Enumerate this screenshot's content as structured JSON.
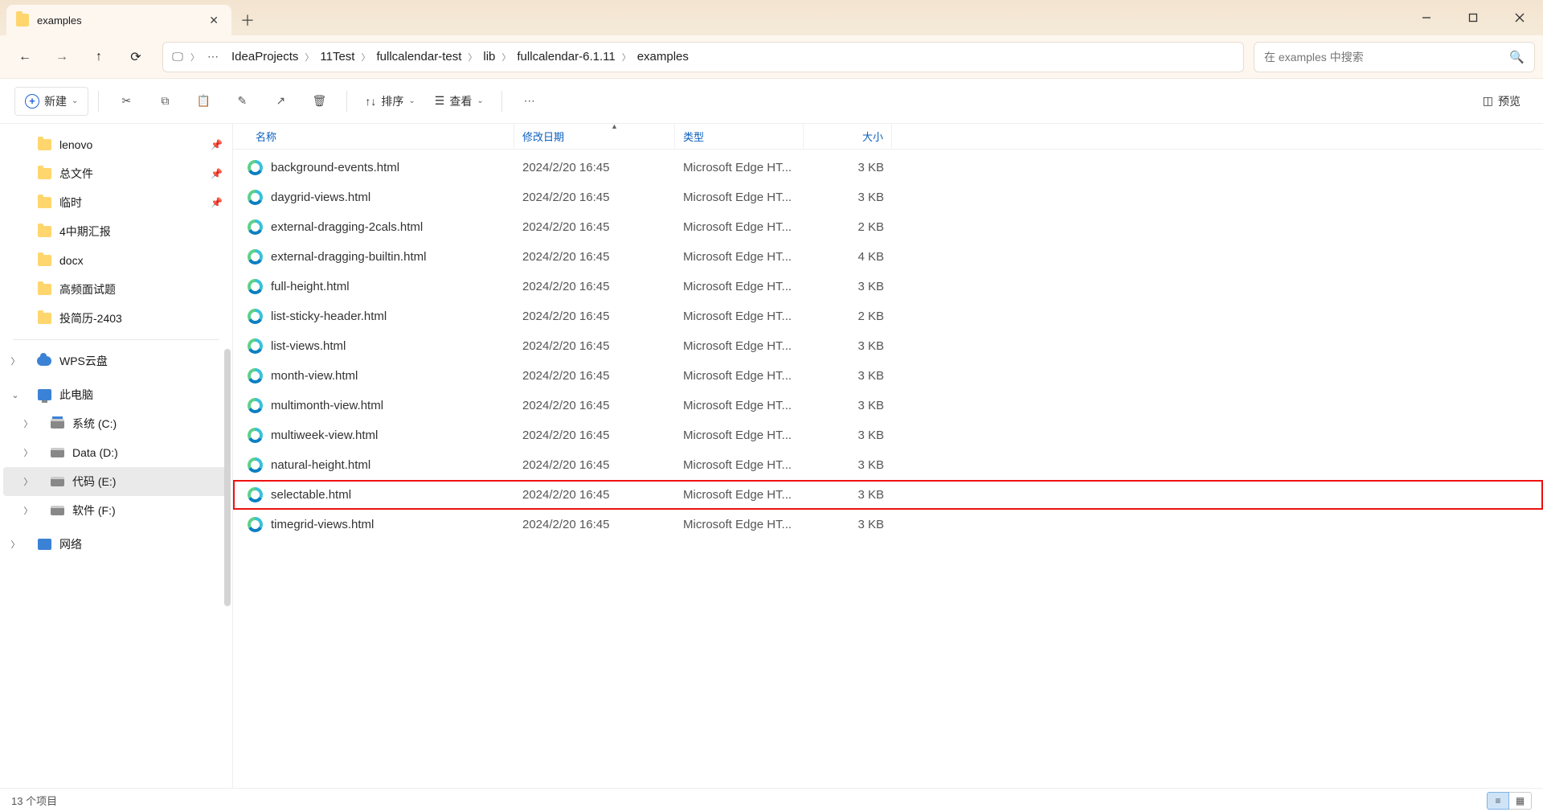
{
  "tab": {
    "title": "examples"
  },
  "breadcrumbs": [
    "IdeaProjects",
    "11Test",
    "fullcalendar-test",
    "lib",
    "fullcalendar-6.1.11",
    "examples"
  ],
  "search": {
    "placeholder": "在 examples 中搜索"
  },
  "toolbar": {
    "new_label": "新建",
    "sort_label": "排序",
    "view_label": "查看",
    "preview_label": "预览"
  },
  "sidebar": {
    "quick": [
      {
        "label": "lenovo",
        "pinned": true
      },
      {
        "label": "总文件",
        "pinned": true
      },
      {
        "label": "临时",
        "pinned": true
      },
      {
        "label": "4中期汇报",
        "pinned": false
      },
      {
        "label": "docx",
        "pinned": false
      },
      {
        "label": "高频面试题",
        "pinned": false
      },
      {
        "label": "投简历-2403",
        "pinned": false
      }
    ],
    "cloud_label": "WPS云盘",
    "pc_label": "此电脑",
    "drives": [
      {
        "label": "系统 (C:)",
        "sys": true
      },
      {
        "label": "Data (D:)",
        "sys": false
      },
      {
        "label": "代码 (E:)",
        "sys": false,
        "selected": true
      },
      {
        "label": "软件 (F:)",
        "sys": false
      }
    ],
    "network_label": "网络"
  },
  "columns": {
    "name": "名称",
    "date": "修改日期",
    "type": "类型",
    "size": "大小"
  },
  "files": [
    {
      "name": "background-events.html",
      "date": "2024/2/20 16:45",
      "type": "Microsoft Edge HT...",
      "size": "3 KB",
      "hl": false
    },
    {
      "name": "daygrid-views.html",
      "date": "2024/2/20 16:45",
      "type": "Microsoft Edge HT...",
      "size": "3 KB",
      "hl": false
    },
    {
      "name": "external-dragging-2cals.html",
      "date": "2024/2/20 16:45",
      "type": "Microsoft Edge HT...",
      "size": "2 KB",
      "hl": false
    },
    {
      "name": "external-dragging-builtin.html",
      "date": "2024/2/20 16:45",
      "type": "Microsoft Edge HT...",
      "size": "4 KB",
      "hl": false
    },
    {
      "name": "full-height.html",
      "date": "2024/2/20 16:45",
      "type": "Microsoft Edge HT...",
      "size": "3 KB",
      "hl": false
    },
    {
      "name": "list-sticky-header.html",
      "date": "2024/2/20 16:45",
      "type": "Microsoft Edge HT...",
      "size": "2 KB",
      "hl": false
    },
    {
      "name": "list-views.html",
      "date": "2024/2/20 16:45",
      "type": "Microsoft Edge HT...",
      "size": "3 KB",
      "hl": false
    },
    {
      "name": "month-view.html",
      "date": "2024/2/20 16:45",
      "type": "Microsoft Edge HT...",
      "size": "3 KB",
      "hl": false
    },
    {
      "name": "multimonth-view.html",
      "date": "2024/2/20 16:45",
      "type": "Microsoft Edge HT...",
      "size": "3 KB",
      "hl": false
    },
    {
      "name": "multiweek-view.html",
      "date": "2024/2/20 16:45",
      "type": "Microsoft Edge HT...",
      "size": "3 KB",
      "hl": false
    },
    {
      "name": "natural-height.html",
      "date": "2024/2/20 16:45",
      "type": "Microsoft Edge HT...",
      "size": "3 KB",
      "hl": false
    },
    {
      "name": "selectable.html",
      "date": "2024/2/20 16:45",
      "type": "Microsoft Edge HT...",
      "size": "3 KB",
      "hl": true
    },
    {
      "name": "timegrid-views.html",
      "date": "2024/2/20 16:45",
      "type": "Microsoft Edge HT...",
      "size": "3 KB",
      "hl": false
    }
  ],
  "status": {
    "count_label": "13 个项目"
  }
}
